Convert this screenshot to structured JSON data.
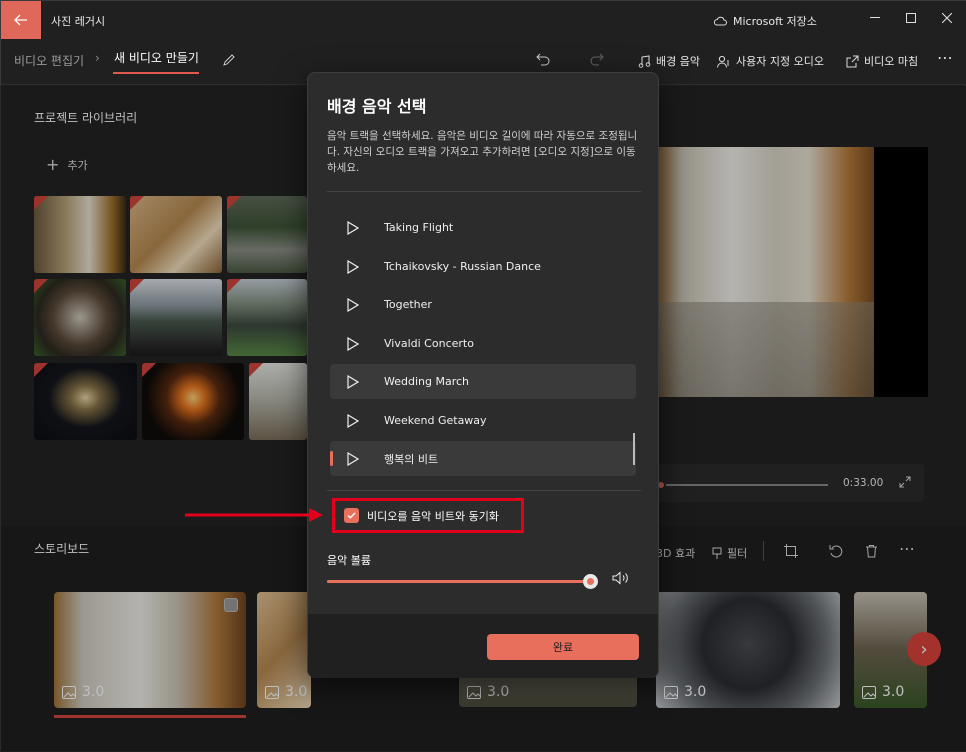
{
  "app": {
    "title": "사진 레거시",
    "cloud": "Microsoft 저장소"
  },
  "breadcrumb": {
    "parent": "비디오 편집기",
    "current": "새 비디오 만들기"
  },
  "toolbar": {
    "bg_music": "배경 음악",
    "custom_audio": "사용자 지정 오디오",
    "finish_video": "비디오 마침"
  },
  "library": {
    "title": "프로젝트 라이브러리",
    "add": "추가"
  },
  "player": {
    "time": "0:33.00"
  },
  "storyboard": {
    "title": "스토리보드",
    "tools": {
      "effects": "3D 효과",
      "filter": "필터"
    },
    "cards": [
      {
        "duration": "3.0"
      },
      {
        "duration": "3.0"
      },
      {
        "duration": "3.0"
      },
      {
        "duration": "3.0"
      },
      {
        "duration": "3.0"
      }
    ]
  },
  "dialog": {
    "title": "배경 음악 선택",
    "description": "음악 트랙을 선택하세요. 음악은 비디오 길이에 따라 자동으로 조정됩니다. 자신의 오디오 트랙을 가져오고 추가하려면 [오디오 지정]으로 이동하세요.",
    "tracks": [
      "Taking Flight",
      "Tchaikovsky - Russian Dance",
      "Together",
      "Vivaldi Concerto",
      "Wedding March",
      "Weekend Getaway",
      "행복의 비트"
    ],
    "highlighted_track": "Wedding March",
    "selected_track": "행복의 비트",
    "sync_label": "비디오를 음악 비트와 동기화",
    "sync_checked": true,
    "volume_label": "음악 볼륨",
    "volume": 1.0,
    "done": "완료"
  },
  "colors": {
    "accent": "#e76f5c",
    "annotation": "#e2001a"
  }
}
